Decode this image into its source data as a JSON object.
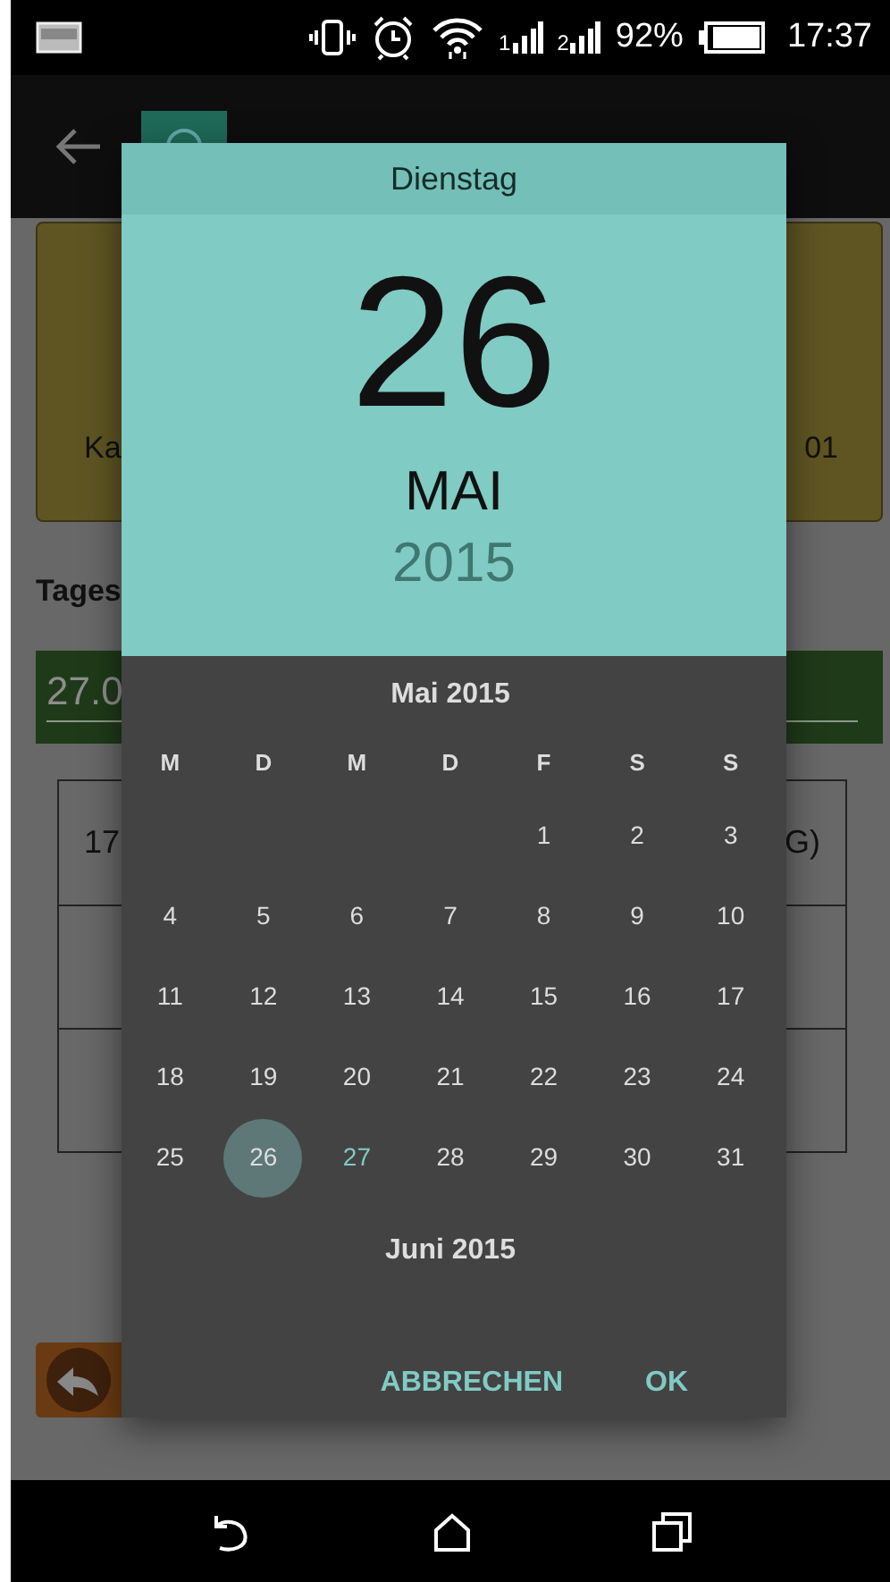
{
  "status_bar": {
    "signals": [
      {
        "label": "1"
      },
      {
        "label": "2"
      }
    ],
    "battery": "92%",
    "time": "17:37"
  },
  "background": {
    "card": {
      "left_text": "Ka",
      "right_text": "01"
    },
    "heading": "Tages",
    "date_field": {
      "value": "27.0"
    },
    "table": {
      "rows": [
        {
          "kind": "text",
          "column_1": "17",
          "column_2": "G)"
        },
        {
          "kind": "empty"
        },
        {
          "kind": "empty"
        }
      ]
    }
  },
  "date_picker": {
    "weekday": "Dienstag",
    "day": "26",
    "month": "MAI",
    "year": "2015",
    "month_title": "Mai 2015",
    "weekday_headers": [
      "M",
      "D",
      "M",
      "D",
      "F",
      "S",
      "S"
    ],
    "weeks": [
      {
        "kind": "partial",
        "days": [
          {
            "label": "1",
            "selected": false,
            "today": false
          },
          {
            "label": "2",
            "selected": false,
            "today": false
          },
          {
            "label": "3",
            "selected": false,
            "today": false
          }
        ]
      },
      {
        "kind": "full",
        "days": [
          {
            "label": "4",
            "selected": false,
            "today": false
          },
          {
            "label": "5",
            "selected": false,
            "today": false
          },
          {
            "label": "6",
            "selected": false,
            "today": false
          },
          {
            "label": "7",
            "selected": false,
            "today": false
          },
          {
            "label": "8",
            "selected": false,
            "today": false
          },
          {
            "label": "9",
            "selected": false,
            "today": false
          },
          {
            "label": "10",
            "selected": false,
            "today": false
          }
        ]
      },
      {
        "kind": "full",
        "days": [
          {
            "label": "11",
            "selected": false,
            "today": false
          },
          {
            "label": "12",
            "selected": false,
            "today": false
          },
          {
            "label": "13",
            "selected": false,
            "today": false
          },
          {
            "label": "14",
            "selected": false,
            "today": false
          },
          {
            "label": "15",
            "selected": false,
            "today": false
          },
          {
            "label": "16",
            "selected": false,
            "today": false
          },
          {
            "label": "17",
            "selected": false,
            "today": false
          }
        ]
      },
      {
        "kind": "full",
        "days": [
          {
            "label": "18",
            "selected": false,
            "today": false
          },
          {
            "label": "19",
            "selected": false,
            "today": false
          },
          {
            "label": "20",
            "selected": false,
            "today": false
          },
          {
            "label": "21",
            "selected": false,
            "today": false
          },
          {
            "label": "22",
            "selected": false,
            "today": false
          },
          {
            "label": "23",
            "selected": false,
            "today": false
          },
          {
            "label": "24",
            "selected": false,
            "today": false
          }
        ]
      },
      {
        "kind": "full",
        "days": [
          {
            "label": "25",
            "selected": false,
            "today": false
          },
          {
            "label": "26",
            "selected": true,
            "today": false
          },
          {
            "label": "27",
            "selected": false,
            "today": true
          },
          {
            "label": "28",
            "selected": false,
            "today": false
          },
          {
            "label": "29",
            "selected": false,
            "today": false
          },
          {
            "label": "30",
            "selected": false,
            "today": false
          },
          {
            "label": "31",
            "selected": false,
            "today": false
          }
        ]
      }
    ],
    "next_month_title": "Juni 2015",
    "buttons": [
      "ABBRECHEN",
      "OK"
    ]
  }
}
